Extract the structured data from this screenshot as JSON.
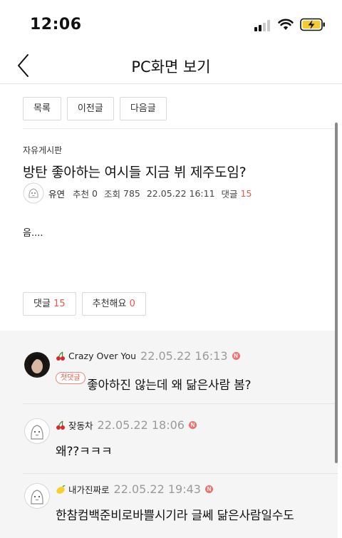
{
  "status_bar": {
    "time": "12:06"
  },
  "nav": {
    "title": "PC화면 보기"
  },
  "post_nav": {
    "list": "목록",
    "prev": "이전글",
    "next": "다음글"
  },
  "post": {
    "board": "자유게시판",
    "title": "방탄 좋아하는 여시들 지금 뷔 제주도임?",
    "author": "유연",
    "likes_label": "추천",
    "likes": "0",
    "views_label": "조회",
    "views": "785",
    "date": "22.05.22 16:11",
    "comments_label": "댓글",
    "comments": "15",
    "body": "음...."
  },
  "post_actions": {
    "comment_label": "댓글",
    "comment_count": "15",
    "recommend_label": "추천해요",
    "recommend_count": "0"
  },
  "comments": [
    {
      "badge": "cherry",
      "name": "Crazy Over You",
      "date": "22.05.22 16:13",
      "new_badge": "N",
      "tag": "첫댓글",
      "text": "좋아하진 않는데 왜 닮은사람 봄?"
    },
    {
      "badge": "cherry",
      "name": "잦동차",
      "date": "22.05.22 18:06",
      "new_badge": "N",
      "text": "왜??ㅋㅋㅋ"
    },
    {
      "badge": "lemon",
      "name": "내가진짜로",
      "date": "22.05.22 19:43",
      "new_badge": "N",
      "text": "한참컴백준비로바쁠시기라 글쎄 닮은사람일수도"
    }
  ],
  "colors": {
    "accent": "#e8584b",
    "comment_bg": "#f5f5f5",
    "divider": "#e3e3e3"
  }
}
